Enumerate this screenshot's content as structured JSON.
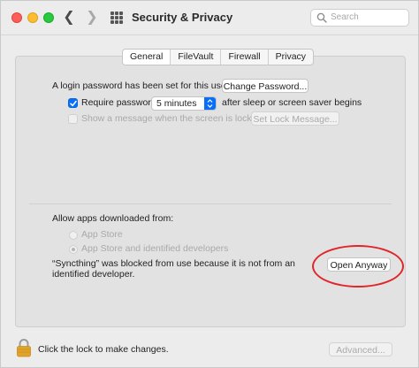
{
  "window": {
    "title": "Security & Privacy",
    "search_placeholder": "Search"
  },
  "tabs": [
    {
      "label": "General",
      "active": true
    },
    {
      "label": "FileVault",
      "active": false
    },
    {
      "label": "Firewall",
      "active": false
    },
    {
      "label": "Privacy",
      "active": false
    }
  ],
  "general": {
    "login_password_text": "A login password has been set for this user",
    "change_password_button": "Change Password...",
    "require_password_label": "Require password",
    "require_password_checked": true,
    "require_password_delay": "5 minutes",
    "after_sleep_text": "after sleep or screen saver begins",
    "show_message_label": "Show a message when the screen is locked",
    "set_lock_message_button": "Set Lock Message..."
  },
  "apps": {
    "allow_label": "Allow apps downloaded from:",
    "option_app_store": "App Store",
    "option_identified": "App Store and identified developers",
    "selected_option": "App Store and identified developers",
    "blocked_line1": "“Syncthing” was blocked from use because it is not from an",
    "blocked_line2": "identified developer.",
    "open_anyway_button": "Open Anyway"
  },
  "footer": {
    "lock_text": "Click the lock to make changes.",
    "advanced_button": "Advanced..."
  },
  "colors": {
    "accent": "#0a6ff8",
    "highlight_ring": "#e0262a",
    "lock": "#e0a42a"
  }
}
